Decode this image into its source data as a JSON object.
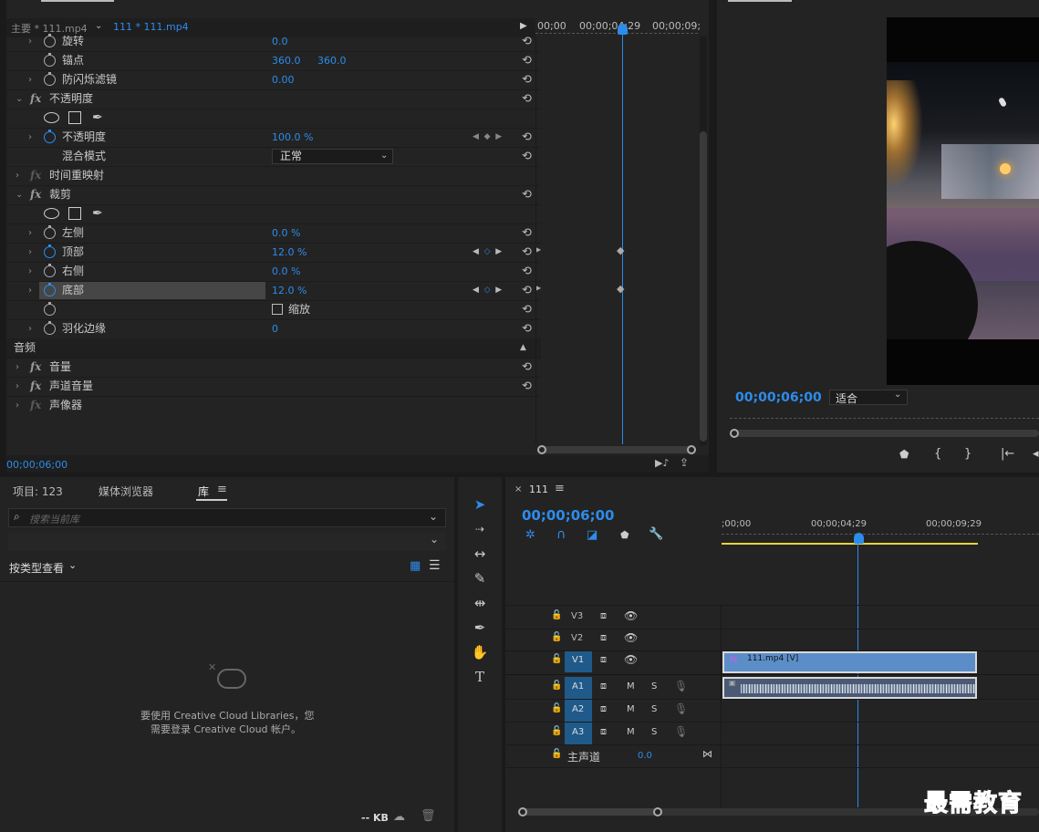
{
  "effect_controls": {
    "tab_master": "主要 * 111.mp4",
    "tab_clip": "111 * 111.mp4",
    "ruler": [
      "00;00",
      "00;00;04;29",
      "00;00;09;"
    ],
    "rows": {
      "rotate": {
        "label": "旋转",
        "value": "0.0"
      },
      "anchor": {
        "label": "锚点",
        "value_x": "360.0",
        "value_y": "360.0"
      },
      "flicker": {
        "label": "防闪烁滤镜",
        "value": "0.00"
      },
      "opacity_group": {
        "label": "不透明度"
      },
      "opacity": {
        "label": "不透明度",
        "value": "100.0 %"
      },
      "blend": {
        "label": "混合模式",
        "value": "正常"
      },
      "time_remap": {
        "label": "时间重映射"
      },
      "crop_group": {
        "label": "裁剪"
      },
      "left": {
        "label": "左侧",
        "value": "0.0 %"
      },
      "top": {
        "label": "顶部",
        "value": "12.0 %"
      },
      "right": {
        "label": "右侧",
        "value": "0.0 %"
      },
      "bottom": {
        "label": "底部",
        "value": "12.0 %"
      },
      "zoom": {
        "label": "缩放"
      },
      "feather": {
        "label": "羽化边缘",
        "value": "0"
      },
      "audio_header": {
        "label": "音频"
      },
      "volume": {
        "label": "音量"
      },
      "channel_volume": {
        "label": "声道音量"
      },
      "panner": {
        "label": "声像器"
      }
    },
    "timecode": "00;00;06;00",
    "fx_symbol": "fx"
  },
  "program_monitor": {
    "timecode": "00;00;06;00",
    "fit": "适合"
  },
  "project_panel": {
    "tabs": [
      "项目: 123",
      "媒体浏览器",
      "库"
    ],
    "search_placeholder": "搜索当前库",
    "view_by": "按类型查看",
    "message_line1": "要使用 Creative Cloud Libraries，您",
    "message_line2": "需要登录 Creative Cloud 帐户。",
    "storage": "-- KB"
  },
  "timeline": {
    "tab": "111",
    "timecode": "00;00;06;00",
    "ruler": [
      ";00;00",
      "00;00;04;29",
      "00;00;09;29"
    ],
    "tracks": {
      "v3": "V3",
      "v2": "V2",
      "v1": "V1",
      "a1": "A1",
      "a2": "A2",
      "a3": "A3",
      "m": "M",
      "s": "S",
      "master_label": "主声道",
      "master_value": "0.0"
    },
    "video_clip": "111.mp4 [V]"
  },
  "watermark": "最需教育"
}
